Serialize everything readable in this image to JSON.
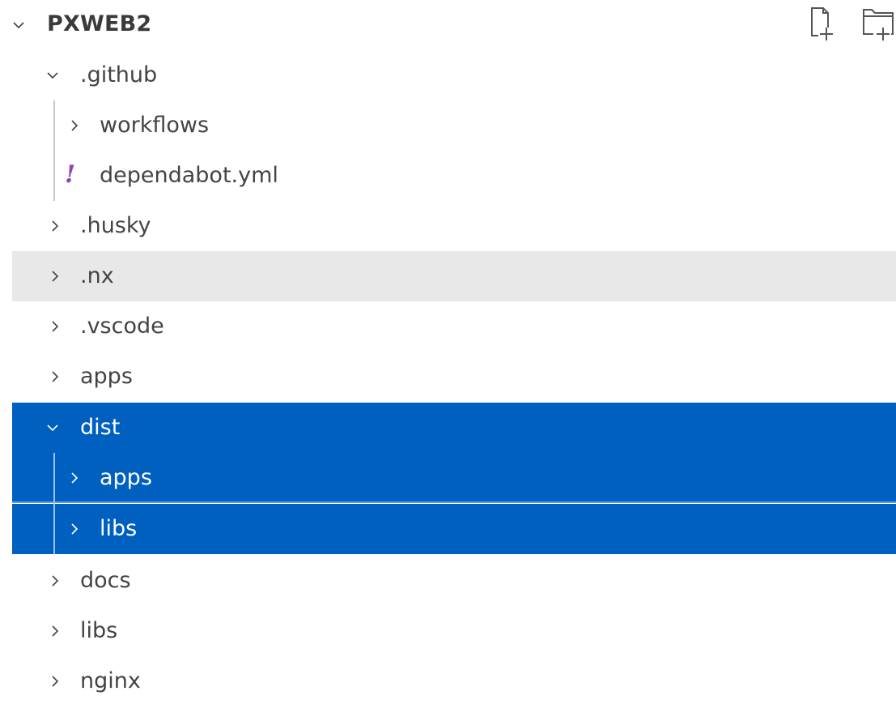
{
  "root": {
    "title": "PXWEB2",
    "actions": [
      {
        "icon": "new-file-icon"
      },
      {
        "icon": "new-folder-icon"
      }
    ]
  },
  "tree": {
    "github": {
      "label": ".github",
      "expanded": true
    },
    "workflows": {
      "label": "workflows"
    },
    "dependabot": {
      "label": "dependabot.yml",
      "icon_glyph": "!"
    },
    "husky": {
      "label": ".husky"
    },
    "nx": {
      "label": ".nx",
      "state": "hover"
    },
    "vscode": {
      "label": ".vscode"
    },
    "apps": {
      "label": "apps"
    },
    "dist": {
      "label": "dist",
      "expanded": true,
      "state": "selected"
    },
    "dist_apps": {
      "label": "apps",
      "state": "selected"
    },
    "dist_libs": {
      "label": "libs",
      "state": "selected"
    },
    "docs": {
      "label": "docs"
    },
    "libs": {
      "label": "libs"
    },
    "nginx": {
      "label": "nginx"
    }
  },
  "colors": {
    "selection": "#0060c0",
    "hover": "#e8e8e8",
    "yaml_icon": "#8e44ad"
  }
}
